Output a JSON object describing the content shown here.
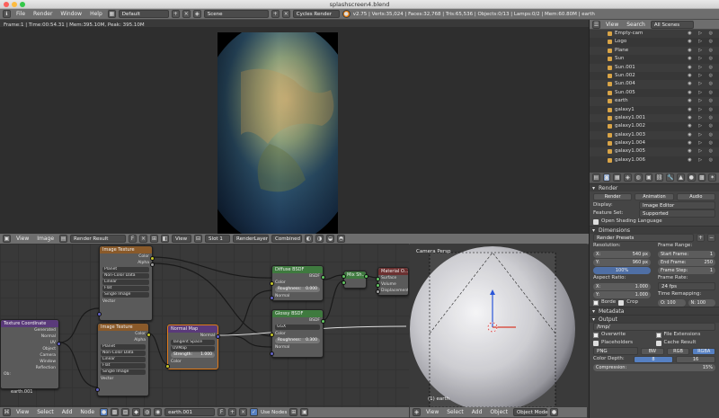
{
  "window": {
    "title": "splashscreen4.blend"
  },
  "topbar": {
    "menus": [
      "File",
      "Render",
      "Window",
      "Help"
    ],
    "layout": "Default",
    "scene": "Scene",
    "engine": "Cycles Render",
    "stats": "v2.75 | Verts:35,024 | Faces:32,768 | Tris:65,536 | Objects:0/13 | Lamps:0/2 | Mem:60.80M | earth"
  },
  "render_view": {
    "frame_info": "Frame:1 | Time:00:54.31 | Mem:395.10M, Peak: 395.10M",
    "header": {
      "menus": [
        "View",
        "Image"
      ],
      "image": "Render Result",
      "view": "View",
      "slot": "Slot 1",
      "layer": "RenderLayer",
      "pass": "Combined"
    }
  },
  "node_editor": {
    "nodes": {
      "image_texture_1": {
        "title": "Image Texture",
        "out_color": "Color",
        "out_alpha": "Alpha",
        "image": "Planet",
        "color_space": "Non-Color Data",
        "interp": "Linear",
        "proj": "Flat",
        "ext": "Single Image",
        "in_vector": "Vector"
      },
      "texture_coord": {
        "title": "Texture Coordinate",
        "rows": [
          "Generated",
          "Normal",
          "UV",
          "Object",
          "Camera",
          "Window",
          "Reflection"
        ],
        "obj_label": "Ob:"
      },
      "image_texture_2": {
        "title": "Image Texture",
        "out_color": "Color",
        "out_alpha": "Alpha",
        "image": "Planet",
        "color_space": "Non-Color Data",
        "interp": "Linear",
        "proj": "Flat",
        "ext": "Single Image",
        "in_vector": "Vector"
      },
      "normal_map": {
        "title": "Normal Map",
        "out": "Normal",
        "space": "Tangent Space",
        "uv": "UVMap",
        "strength_label": "Strength:",
        "strength": "1.000",
        "in_color": "Color"
      },
      "diffuse": {
        "title": "Diffuse BSDF",
        "out": "BSDF",
        "in_color": "Color",
        "rough_label": "Roughness:",
        "rough": "0.000",
        "in_normal": "Normal"
      },
      "glossy": {
        "title": "Glossy BSDF",
        "out": "BSDF",
        "dist": "GGX",
        "in_color": "Color",
        "rough_label": "Roughness:",
        "rough": "0.300",
        "in_normal": "Normal"
      },
      "mix": {
        "title": "Mix Sh..."
      },
      "output": {
        "title": "Material O...",
        "rows": [
          "Surface",
          "Volume",
          "Displacement"
        ]
      }
    },
    "obj_name": "earth.001",
    "footer": {
      "menus": [
        "View",
        "Select",
        "Add",
        "Node"
      ],
      "material": "earth.001",
      "use_nodes": "Use Nodes"
    }
  },
  "viewport3d": {
    "label": "Camera Persp",
    "object_label": "(1) earth",
    "footer": {
      "menus": [
        "View",
        "Select",
        "Add",
        "Object"
      ],
      "mode": "Object Mode"
    }
  },
  "outliner": {
    "header": {
      "view": "View",
      "search": "Search",
      "scope": "All Scenes"
    },
    "items": [
      "Empty-cam",
      "Logo",
      "Plane",
      "Sun",
      "Sun.001",
      "Sun.002",
      "Sun.004",
      "Sun.005",
      "earth",
      "galaxy1",
      "galaxy1.001",
      "galaxy1.002",
      "galaxy1.003",
      "galaxy1.004",
      "galaxy1.005",
      "galaxy1.006"
    ],
    "vis_glyphs": "◉ ▷ ◎"
  },
  "properties": {
    "render": {
      "header": "Render",
      "buttons": [
        "Render",
        "Animation",
        "Audio"
      ],
      "display_label": "Display:",
      "display": "Image Editor",
      "feature_label": "Feature Set:",
      "feature": "Supported",
      "osl": "Open Shading Language"
    },
    "dimensions": {
      "header": "Dimensions",
      "preset": "Render Presets",
      "resolution_label": "Resolution:",
      "x_label": "X:",
      "x": "540 px",
      "y_label": "Y:",
      "y": "960 px",
      "pct": "100%",
      "aspect_label": "Aspect Ratio:",
      "ax": "1.000",
      "ay": "1.000",
      "border": "Borde",
      "crop": "Crop",
      "frame_range_label": "Frame Range:",
      "start_label": "Start Frame:",
      "start": "1",
      "end_label": "End Frame:",
      "end": "250",
      "step_label": "Frame Step:",
      "step": "1",
      "fps_label": "Frame Rate:",
      "fps": "24 fps",
      "remap_label": "Time Remapping:",
      "remap_o": "O: 100",
      "remap_n": "N: 100"
    },
    "metadata": {
      "header": "Metadata"
    },
    "output": {
      "header": "Output",
      "path": "/tmp/",
      "overwrite": "Overwrite",
      "extensions": "File Extensions",
      "placeholders": "Placeholders",
      "cache": "Cache Result",
      "format": "PNG",
      "bw": "BW",
      "rgb": "RGB",
      "rgba": "RGBA",
      "depth_label": "Color Depth:",
      "depth8": "8",
      "depth16": "16",
      "compression_label": "Compression:",
      "compression": "15%"
    }
  }
}
